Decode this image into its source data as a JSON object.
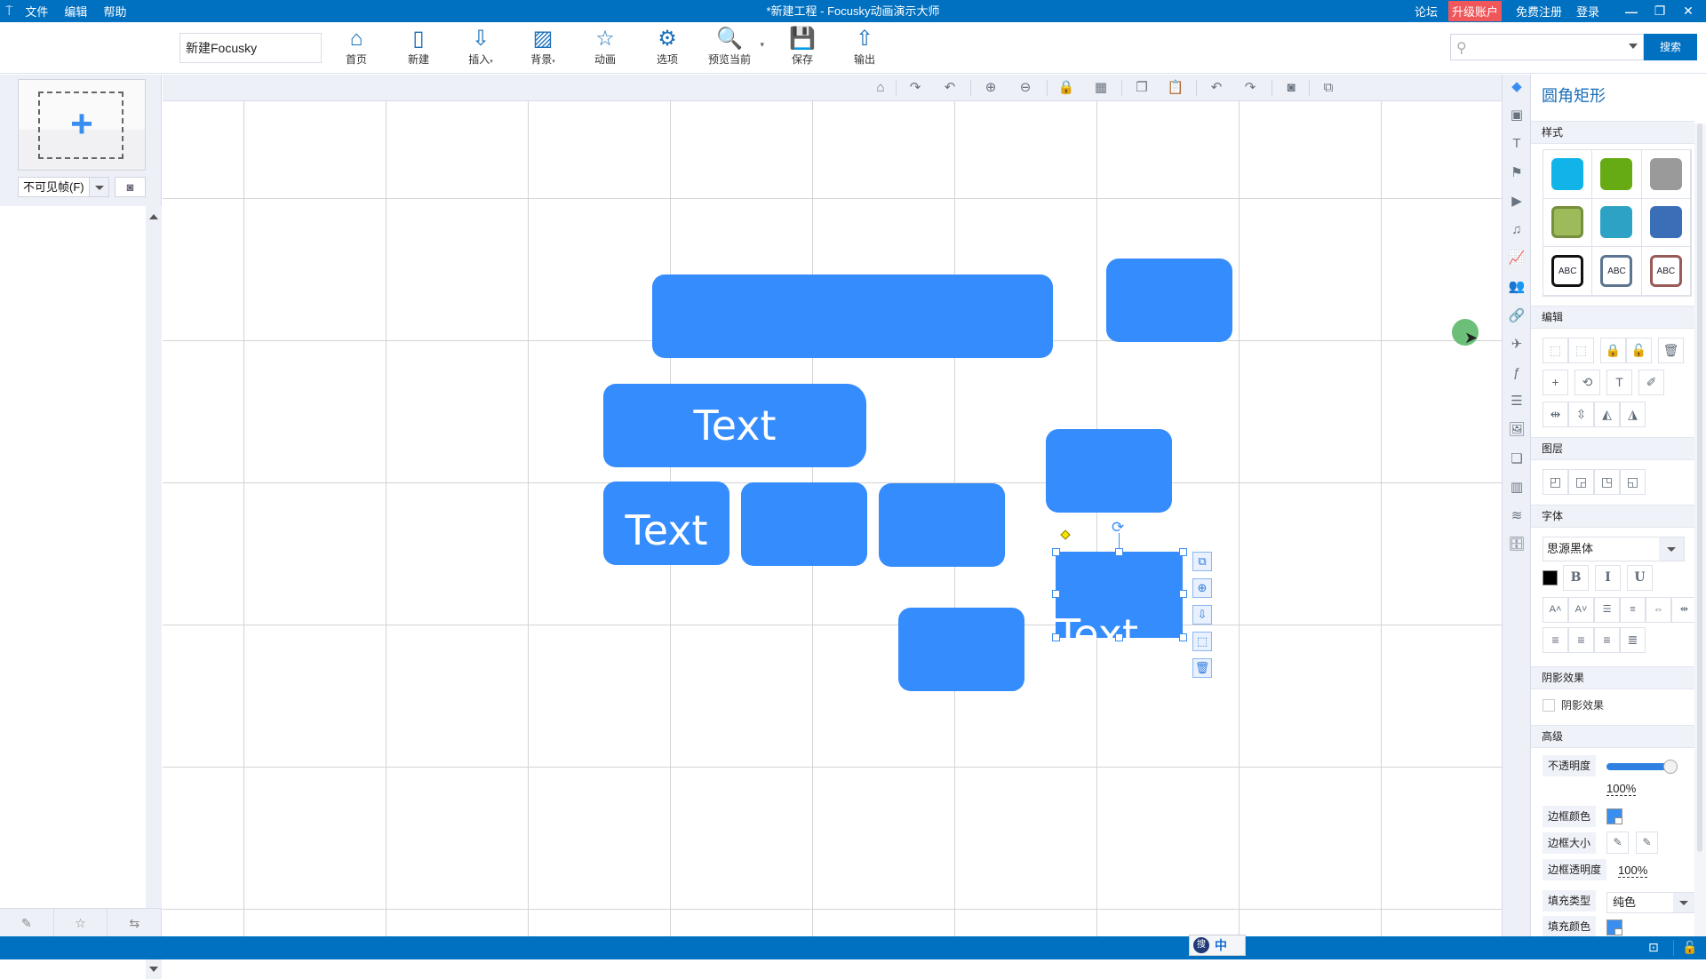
{
  "titlebar": {
    "menu": [
      "文件",
      "编辑",
      "帮助"
    ],
    "title": "*新建工程 - Focusky动画演示大师",
    "links": {
      "forum": "论坛",
      "upgrade": "升级账户",
      "register": "免费注册",
      "login": "登录"
    },
    "window_buttons": {
      "minimize": "—",
      "restore": "❐",
      "close": "✕"
    }
  },
  "toolbar": {
    "project_name": "新建Focusky",
    "buttons": [
      {
        "id": "home",
        "label": "首页",
        "icon": "home-icon",
        "glyph": "⌂"
      },
      {
        "id": "new",
        "label": "新建",
        "icon": "new-page-icon",
        "glyph": "▯"
      },
      {
        "id": "insert",
        "label": "插入",
        "icon": "insert-icon",
        "glyph": "⇩",
        "has_menu": true
      },
      {
        "id": "background",
        "label": "背景",
        "icon": "background-icon",
        "glyph": "▨",
        "has_menu": true
      },
      {
        "id": "animation",
        "label": "动画",
        "icon": "animation-star-icon",
        "glyph": "☆"
      },
      {
        "id": "options",
        "label": "选项",
        "icon": "gear-icon",
        "glyph": "⚙"
      },
      {
        "id": "preview",
        "label": "预览当前",
        "icon": "preview-icon",
        "glyph": "🔍",
        "has_menu": true
      },
      {
        "id": "save",
        "label": "保存",
        "icon": "save-icon",
        "glyph": "💾"
      },
      {
        "id": "export",
        "label": "输出",
        "icon": "export-icon",
        "glyph": "⇧"
      }
    ],
    "menu_caret": "▾",
    "search": {
      "placeholder": "",
      "value": "",
      "button_label": "搜索"
    }
  },
  "left_panel": {
    "add_frame_symbol": "+",
    "frame_visibility": "不可见帧(F)",
    "snapshot_glyph": "◙",
    "bottom_tools": [
      {
        "name": "edit-frame-icon",
        "glyph": "✎"
      },
      {
        "name": "frame-favorite-icon",
        "glyph": "☆"
      },
      {
        "name": "frame-transfer-icon",
        "glyph": "⇆"
      }
    ]
  },
  "canvas_toolbar": [
    {
      "name": "home-view-icon",
      "glyph": "⌂"
    },
    {
      "name": "rotate-right-icon",
      "glyph": "↷"
    },
    {
      "name": "rotate-left-icon",
      "glyph": "↶"
    },
    {
      "name": "zoom-in-icon",
      "glyph": "⊕"
    },
    {
      "name": "zoom-out-icon",
      "glyph": "⊖"
    },
    {
      "name": "lock-icon",
      "glyph": "🔒"
    },
    {
      "name": "grid-icon",
      "glyph": "▦"
    },
    {
      "name": "copy-icon",
      "glyph": "❐"
    },
    {
      "name": "paste-icon",
      "glyph": "📋"
    },
    {
      "name": "undo-icon",
      "glyph": "↶"
    },
    {
      "name": "redo-icon",
      "glyph": "↷"
    },
    {
      "name": "screenshot-icon",
      "glyph": "◙"
    },
    {
      "name": "window-icon",
      "glyph": "⧉"
    }
  ],
  "canvas": {
    "shape_color": "#358cfc",
    "shapes": [
      {
        "id": "wide-bar",
        "text": ""
      },
      {
        "id": "top-right",
        "text": ""
      },
      {
        "id": "text-wide",
        "text": "Text"
      },
      {
        "id": "text-small",
        "text": "Text"
      },
      {
        "id": "mid-1",
        "text": ""
      },
      {
        "id": "mid-2",
        "text": ""
      },
      {
        "id": "right-mid",
        "text": ""
      },
      {
        "id": "bottom",
        "text": ""
      },
      {
        "id": "selected",
        "text": "Text"
      }
    ],
    "selection_actions": [
      {
        "name": "duplicate-icon",
        "glyph": "⧉"
      },
      {
        "name": "add-circle-icon",
        "glyph": "⊕"
      },
      {
        "name": "store-icon",
        "glyph": "⇩"
      },
      {
        "name": "select-path-icon",
        "glyph": "⬚"
      },
      {
        "name": "trash-icon",
        "glyph": "🗑"
      }
    ],
    "rotate_glyph": "⟳"
  },
  "rail": [
    {
      "name": "shape-icon",
      "glyph": "◆",
      "active": true
    },
    {
      "name": "image-icon",
      "glyph": "▣"
    },
    {
      "name": "text-icon",
      "glyph": "T"
    },
    {
      "name": "banner-icon",
      "glyph": "⚑"
    },
    {
      "name": "video-icon",
      "glyph": "▶"
    },
    {
      "name": "music-icon",
      "glyph": "♫"
    },
    {
      "name": "chart-icon",
      "glyph": "📈"
    },
    {
      "name": "people-icon",
      "glyph": "👥"
    },
    {
      "name": "link-icon",
      "glyph": "🔗"
    },
    {
      "name": "plane-icon",
      "glyph": "✈"
    },
    {
      "name": "flash-icon",
      "glyph": "ƒ"
    },
    {
      "name": "list-icon",
      "glyph": "☰"
    },
    {
      "name": "gallery-icon",
      "glyph": "🖼"
    },
    {
      "name": "pages-icon",
      "glyph": "❏"
    },
    {
      "name": "layout-icon",
      "glyph": "▥"
    },
    {
      "name": "layers-icon",
      "glyph": "≋"
    },
    {
      "name": "archive-icon",
      "glyph": "🗄"
    }
  ],
  "props": {
    "title": "圆角矩形",
    "sections": {
      "style": "样式",
      "edit": "编辑",
      "layer": "图层",
      "font": "字体",
      "shadow": "阴影效果",
      "advanced": "高级"
    },
    "style_swatches": [
      {
        "color": "#10b4e8",
        "text": ""
      },
      {
        "color": "#66ab14",
        "text": ""
      },
      {
        "color": "#9a9a9a",
        "text": ""
      },
      {
        "color": "#9dbb5a",
        "border": "#768f3c",
        "text": ""
      },
      {
        "color": "#2ea2c4",
        "text": ""
      },
      {
        "color": "#3a6fb8",
        "text": ""
      },
      {
        "color": "#ffffff",
        "border": "#111111",
        "text": "ABC"
      },
      {
        "color": "#ffffff",
        "border": "#5c7590",
        "text": "ABC"
      },
      {
        "color": "#ffffff",
        "border": "#9a5a58",
        "text": "ABC"
      }
    ],
    "edit_tools": [
      {
        "name": "group-icon",
        "glyph": "⬚",
        "dim": true
      },
      {
        "name": "ungroup-icon",
        "glyph": "⬚",
        "dim": true
      },
      {
        "name": "lock-icon",
        "glyph": "🔒"
      },
      {
        "name": "unlock-icon",
        "glyph": "🔓",
        "dim": true
      },
      {
        "name": "delete-icon",
        "glyph": "🗑"
      },
      {
        "name": "add-icon",
        "glyph": "+"
      },
      {
        "name": "reset-rotate-icon",
        "glyph": "⟲"
      },
      {
        "name": "text-tool-icon",
        "glyph": "T"
      },
      {
        "name": "format-brush-icon",
        "glyph": "✐"
      },
      {
        "name": "flip-horizontal-icon",
        "glyph": "⇹"
      },
      {
        "name": "flip-vertical-icon",
        "glyph": "⇳"
      },
      {
        "name": "mirror-left-icon",
        "glyph": "◭"
      },
      {
        "name": "mirror-right-icon",
        "glyph": "◮"
      }
    ],
    "layer_tools": [
      {
        "name": "bring-front-icon",
        "glyph": "◰"
      },
      {
        "name": "send-back-icon",
        "glyph": "◲"
      },
      {
        "name": "bring-forward-icon",
        "glyph": "◳"
      },
      {
        "name": "send-backward-icon",
        "glyph": "◱"
      }
    ],
    "font": {
      "family": "思源黑体",
      "color": "#000000",
      "style_buttons": [
        {
          "name": "bold-icon",
          "glyph": "B"
        },
        {
          "name": "italic-icon",
          "glyph": "I"
        },
        {
          "name": "underline-icon",
          "glyph": "U"
        }
      ],
      "format_buttons": [
        {
          "name": "font-size-up-icon",
          "glyph": "A˄"
        },
        {
          "name": "font-size-down-icon",
          "glyph": "A˅"
        },
        {
          "name": "line-spacing-icon",
          "glyph": "☰"
        },
        {
          "name": "paragraph-spacing-icon",
          "glyph": "≡"
        },
        {
          "name": "letter-spacing-expand-icon",
          "glyph": "⇔"
        },
        {
          "name": "letter-spacing-shrink-icon",
          "glyph": "⇹"
        }
      ],
      "align_buttons": [
        {
          "name": "align-left-icon",
          "glyph": "≡"
        },
        {
          "name": "align-center-icon",
          "glyph": "≡"
        },
        {
          "name": "align-right-icon",
          "glyph": "≡"
        },
        {
          "name": "align-justify-icon",
          "glyph": "≣"
        }
      ]
    },
    "shadow": {
      "label": "阴影效果",
      "checked": false
    },
    "advanced": {
      "opacity_label": "不透明度",
      "opacity_value": "100%",
      "opacity_fraction": 1.0,
      "border_color_label": "边框颜色",
      "border_color": "#3a8ef0",
      "border_size_label": "边框大小",
      "border_opacity_label": "边框透明度",
      "border_opacity_value": "100%",
      "fill_type_label": "填充类型",
      "fill_type_value": "纯色",
      "fill_color_label": "填充颜色",
      "fill_color": "#3a8ef0"
    }
  },
  "statusbar": {
    "ime_mode": "中",
    "ime_logo": "搜"
  }
}
